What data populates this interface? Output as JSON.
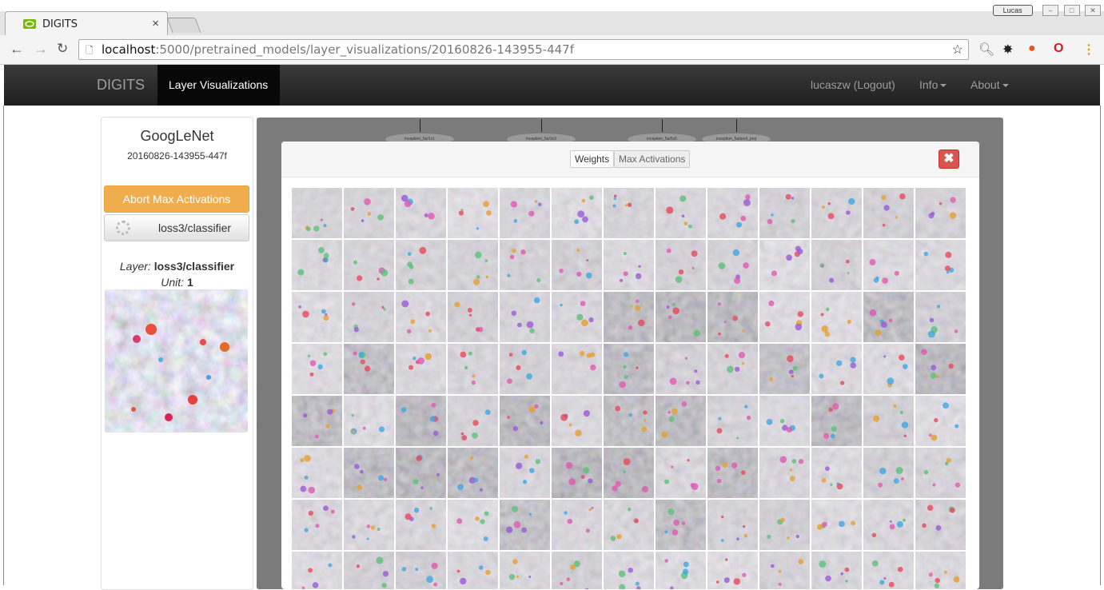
{
  "browser": {
    "tab_title": "DIGITS",
    "tab_close": "×",
    "url_host": "localhost",
    "url_rest": ":5000/pretrained_models/layer_visualizations/20160826-143955-447f",
    "profile_label": "Lucas",
    "nav_icons": [
      "back-icon",
      "forward-icon",
      "reload-icon",
      "page-icon",
      "bookmark-star-icon"
    ],
    "extension_icons": [
      "search-extension-icon",
      "gear-extension-icon",
      "fire-extension-icon",
      "opera-extension-icon",
      "menu-kebab-icon"
    ]
  },
  "navbar": {
    "brand": "DIGITS",
    "active_tab": "Layer Visualizations",
    "user": "lucaszw (Logout)",
    "info": "Info",
    "about": "About"
  },
  "sidebar": {
    "model_name": "GoogLeNet",
    "job_id": "20160826-143955-447f",
    "abort_button": "Abort Max Activations",
    "layer_button": "loss3/classifier",
    "layer_label": "Layer:",
    "layer_value": "loss3/classifier",
    "unit_label": "Unit:",
    "unit_value": "1"
  },
  "graph": {
    "nodes": [
      "inception_5a/1x1",
      "inception_5a/3x3",
      "inception_5a/5x5",
      "inception_5a/pool_proj"
    ]
  },
  "modal": {
    "weights_button": "Weights",
    "max_activations_button": "Max Activations",
    "close_button": "✖",
    "grid_columns": 13,
    "grid_rows_visible": 8
  },
  "colors": {
    "navbar": "#222222",
    "abort": "#f0ad4e",
    "close": "#d9534f",
    "graph_bg": "#7b7b7b"
  }
}
